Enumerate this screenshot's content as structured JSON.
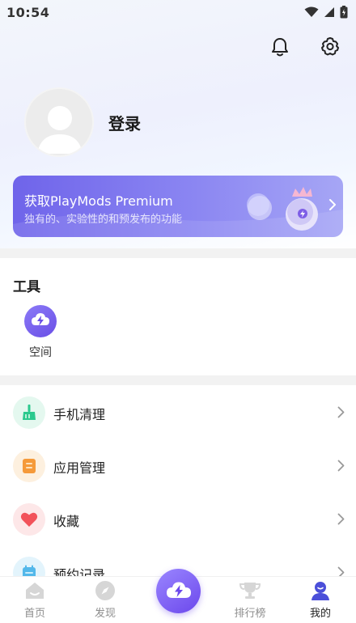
{
  "status_bar": {
    "time": "10:54"
  },
  "profile": {
    "login_label": "登录"
  },
  "premium": {
    "title": "获取PlayMods Premium",
    "subtitle": "独有的、实验性的和预发布的功能"
  },
  "tools": {
    "heading": "工具",
    "items": [
      {
        "label": "空间",
        "icon": "space-icon"
      }
    ]
  },
  "menu": [
    {
      "label": "手机清理",
      "icon": "broom-icon",
      "color": "#2bc98e",
      "bg": "#e4f8ef"
    },
    {
      "label": "应用管理",
      "icon": "app-manage-icon",
      "color": "#f59a3a",
      "bg": "#fdf0df"
    },
    {
      "label": "收藏",
      "icon": "heart-icon",
      "color": "#f2525a",
      "bg": "#fde7e8"
    },
    {
      "label": "预约记录",
      "icon": "calendar-icon",
      "color": "#53b8ea",
      "bg": "#e3f4fc"
    }
  ],
  "bottom_nav": {
    "items": [
      {
        "label": "首页",
        "icon": "home-icon"
      },
      {
        "label": "发现",
        "icon": "compass-icon"
      },
      {
        "label": "排行榜",
        "icon": "trophy-icon"
      },
      {
        "label": "我的",
        "icon": "profile-icon",
        "active": true
      }
    ]
  },
  "colors": {
    "accent": "#6c48ec",
    "premium_start": "#6f64ea",
    "premium_end": "#a6a6f5"
  }
}
